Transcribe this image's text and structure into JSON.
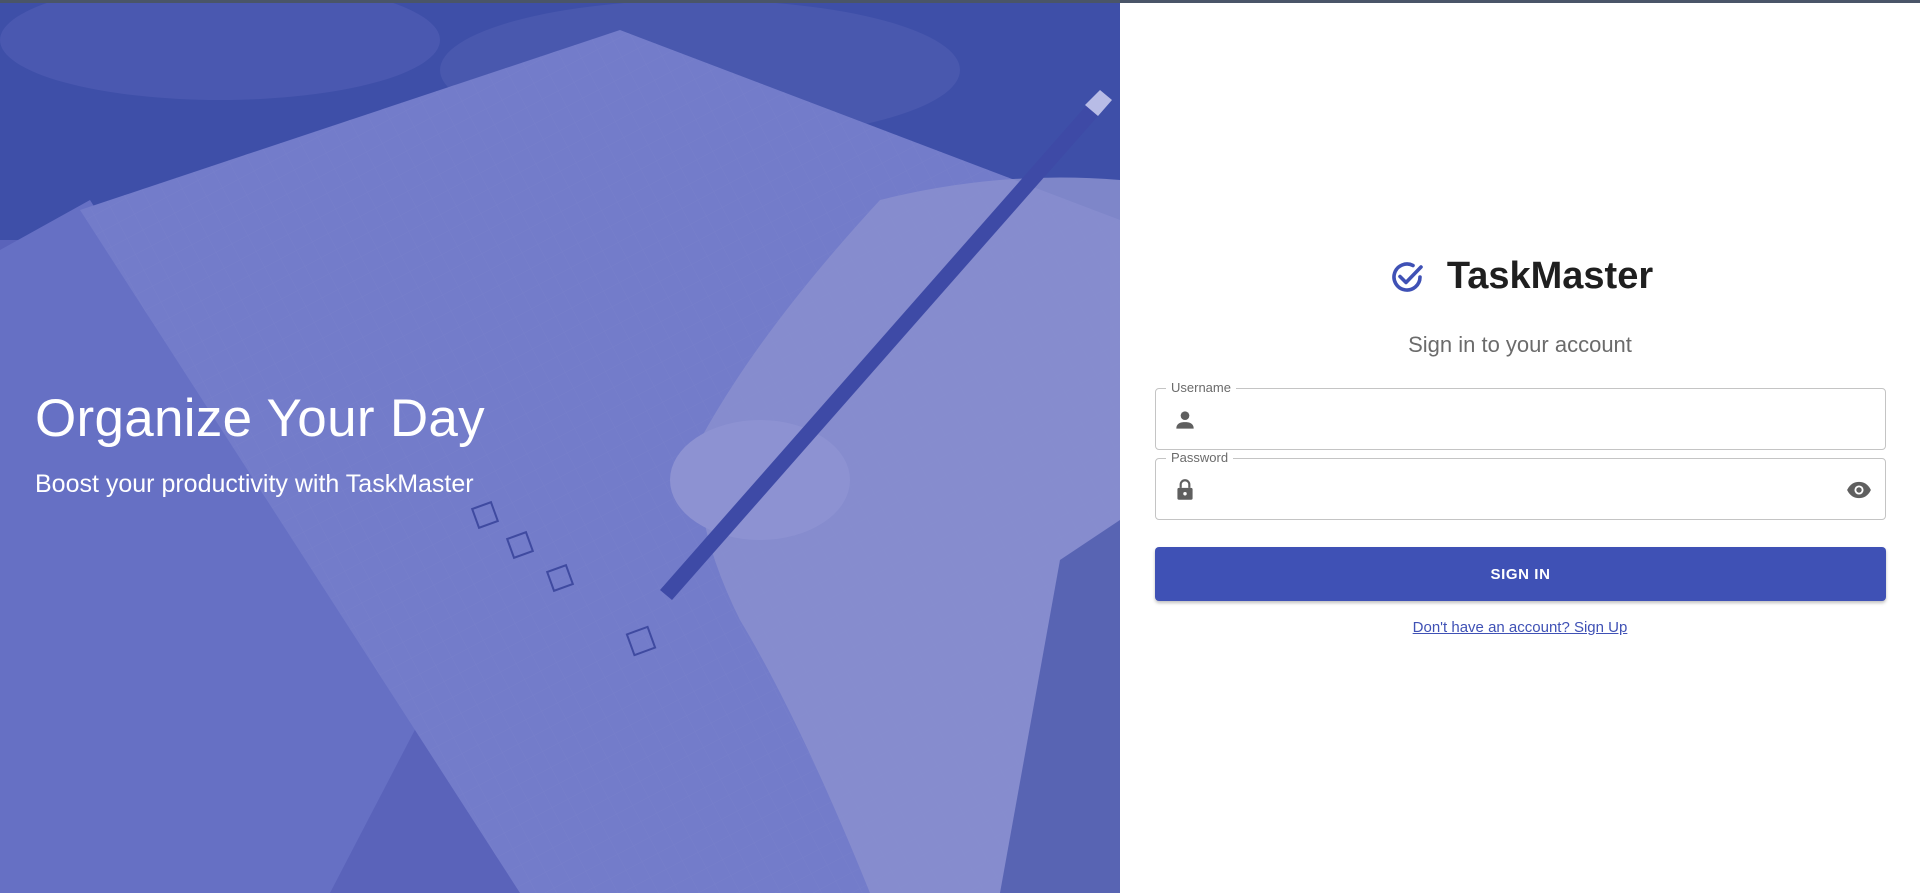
{
  "hero": {
    "title": "Organize Your Day",
    "subtitle": "Boost your productivity with TaskMaster"
  },
  "brand": {
    "name": "TaskMaster",
    "icon": "check-circle-icon",
    "accent_color": "#3f51b5"
  },
  "form": {
    "subtitle": "Sign in to your account",
    "username": {
      "label": "Username",
      "value": "",
      "icon": "person-icon"
    },
    "password": {
      "label": "Password",
      "value": "",
      "icon": "lock-icon",
      "toggle_icon": "eye-icon"
    },
    "submit_label": "SIGN IN",
    "signup_link": "Don't have an account? Sign Up"
  }
}
